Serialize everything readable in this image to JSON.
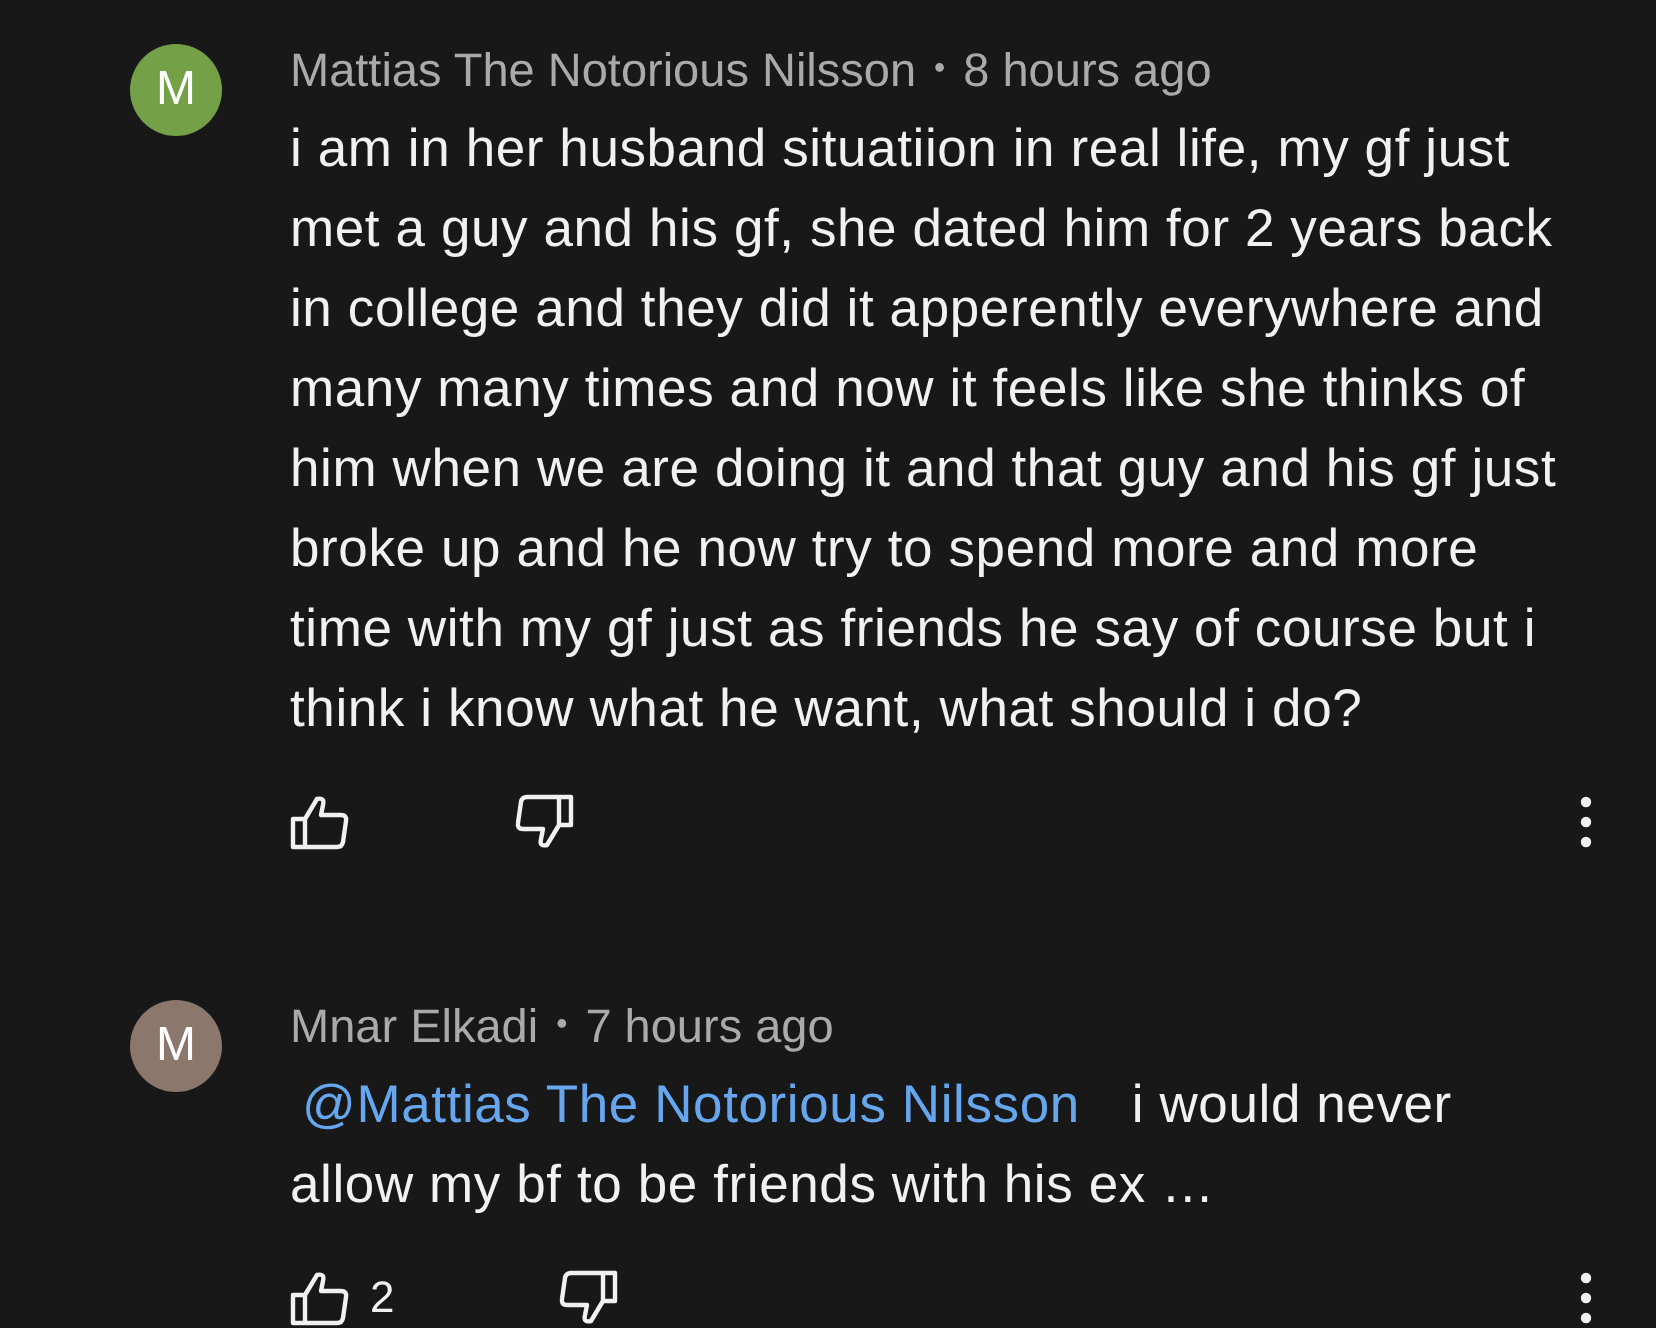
{
  "comments": [
    {
      "avatar": "M",
      "color": "#74a047",
      "author": "Mattias The Notorious Nilsson",
      "separator": "•",
      "time": "8 hours ago",
      "text": "i am in her husband situatiion in real life, my gf just met a guy and his gf, she dated him for 2 years back in college and they did it apperently everywhere and many many times and now it feels like she thinks of him when we are doing it and that guy and his gf just broke up and he now try to spend more and more time with my gf just as friends he say of course but i think i know what he want, what should i do?"
    },
    {
      "avatar": "M",
      "color": "#8b776c",
      "author": "Mnar Elkadi",
      "separator": "•",
      "time": "7 hours ago",
      "mention": "@Mattias The Notorious Nilsson",
      "text": "i would never allow my bf to be friends with his ex …",
      "like_count": "2"
    }
  ]
}
